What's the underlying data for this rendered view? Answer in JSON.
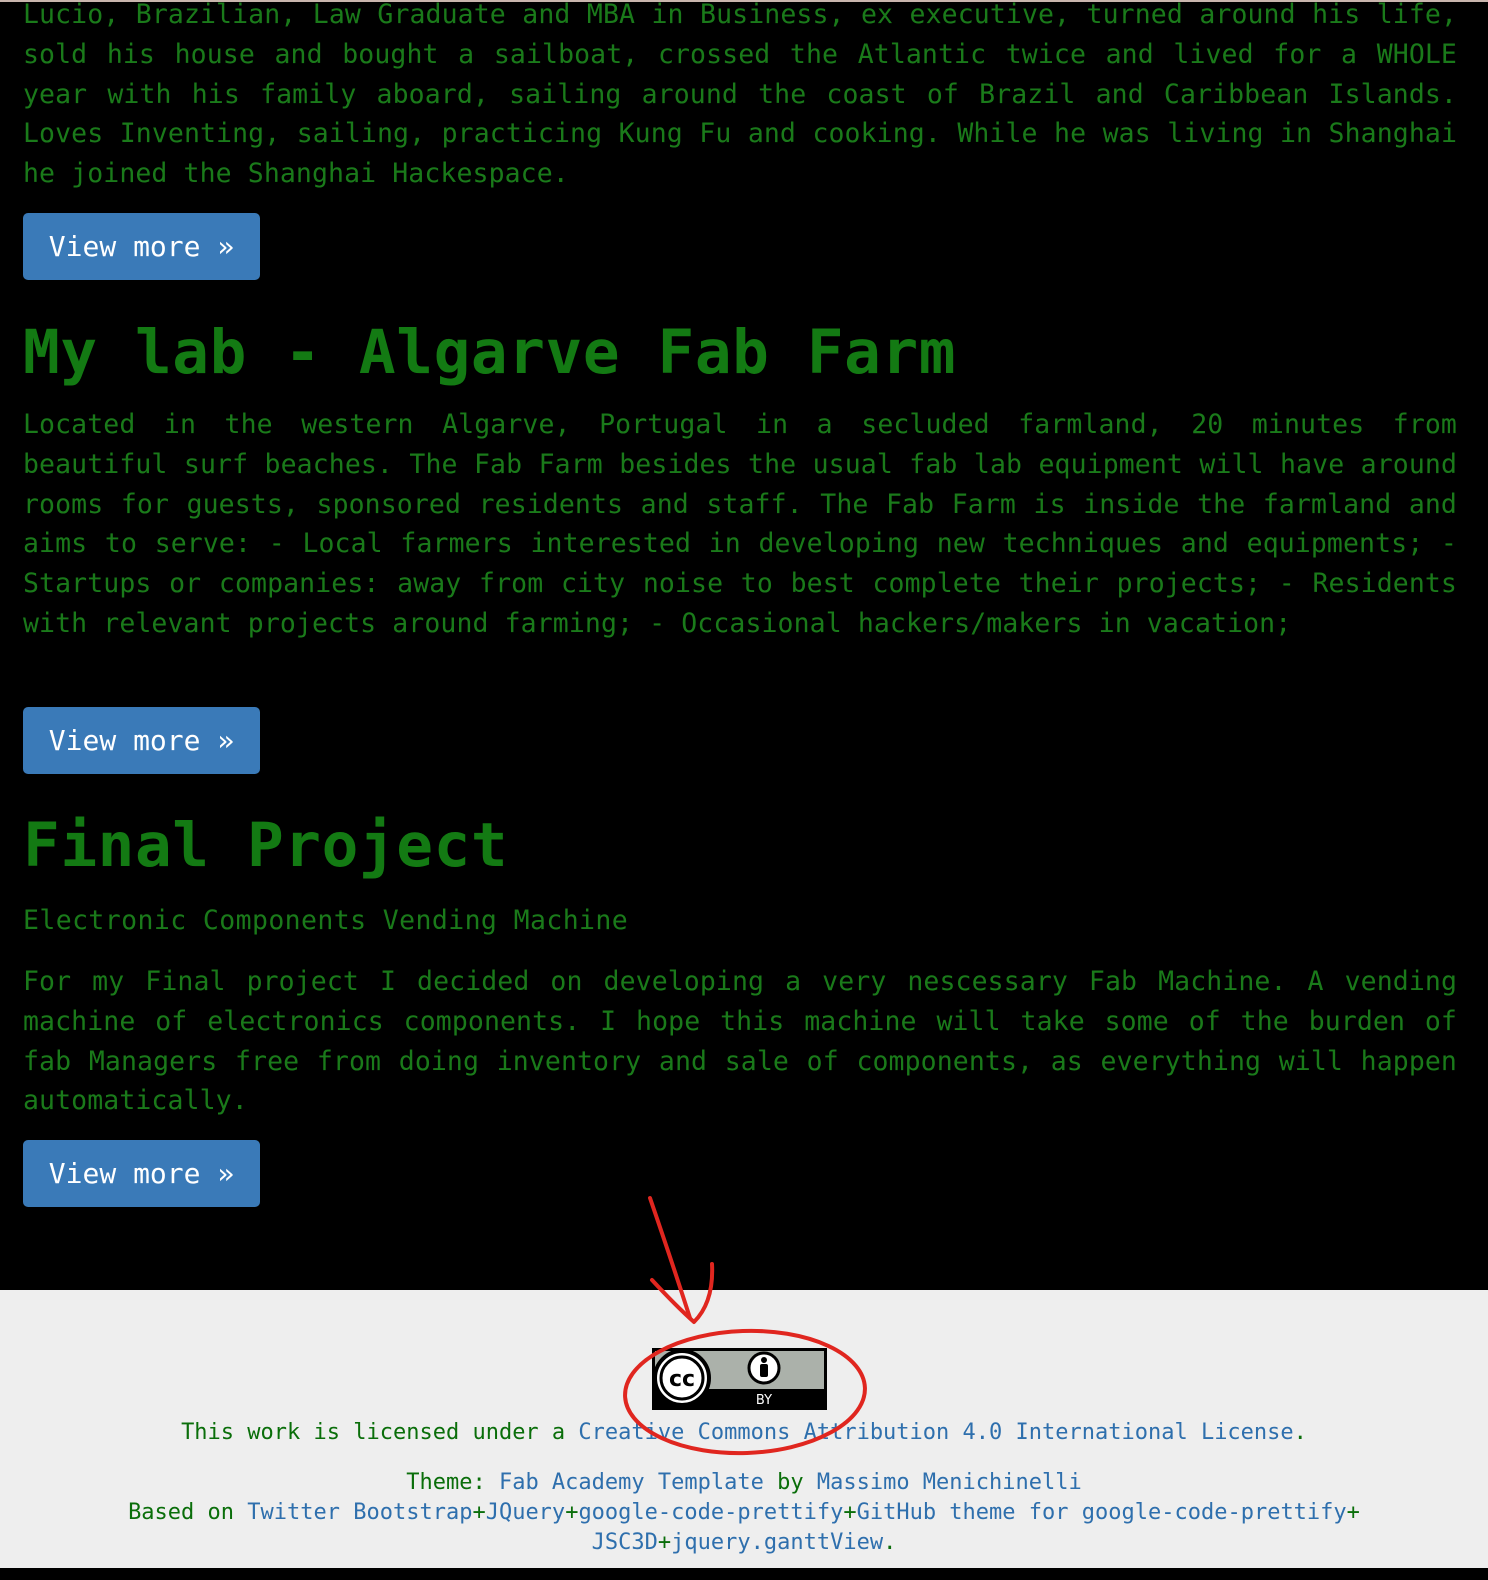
{
  "bio": {
    "text": "Lucio, Brazilian, Law Graduate and MBA in Business, ex executive, turned around his life, sold his house and bought a sailboat, crossed the Atlantic twice and lived for a WHOLE year with his family aboard, sailing around the coast of Brazil and Caribbean Islands. Loves Inventing, sailing, practicing Kung Fu and cooking. While he was living in Shanghai he joined the Shanghai Hackespace.",
    "button_label": "View more »"
  },
  "lab": {
    "title": "My lab - Algarve Fab Farm",
    "text": "Located in the western Algarve, Portugal in a secluded farmland, 20 minutes from beautiful surf beaches. The Fab Farm besides the usual fab lab equipment will have around rooms for guests, sponsored residents and staff. The Fab Farm is inside the farmland and aims to serve: - Local farmers interested in developing new techniques and equipments; - Startups or companies: away from city noise to best complete their projects; - Residents with relevant projects around farming; - Occasional hackers/makers in vacation;",
    "button_label": "View more »"
  },
  "final_project": {
    "title": "Final Project",
    "subtitle": "Electronic Components Vending Machine",
    "text": "For my Final project I decided on developing a very nescessary Fab Machine. A vending machine of electronics components. I hope this machine will take some of the burden of fab Managers free from doing inventory and sale of components, as everything will happen automatically.",
    "button_label": "View more »"
  },
  "footer": {
    "badge": {
      "cc": "cc",
      "by": "BY",
      "icon": "creative-commons-by-icon"
    },
    "license_prefix": "This work is licensed under a ",
    "license_link": "Creative Commons Attribution 4.0 International License",
    "license_suffix": ".",
    "theme_prefix": "Theme: ",
    "theme_link": "Fab Academy Template",
    "theme_by": " by ",
    "theme_author": "Massimo Menichinelli",
    "based_prefix": "Based on ",
    "based_links": [
      "Twitter Bootstrap",
      "JQuery",
      "google-code-prettify",
      "GitHub theme for google-code-prettify",
      "JSC3D",
      "jquery.ganttView"
    ],
    "plus": "+",
    "based_suffix": "."
  },
  "colors": {
    "background": "#000000",
    "text_green": "#1a7a1a",
    "button_blue": "#3a7ab8",
    "footer_bg": "#eeeeee",
    "link_blue": "#2e6fad",
    "annotation_red": "#e0261f"
  }
}
